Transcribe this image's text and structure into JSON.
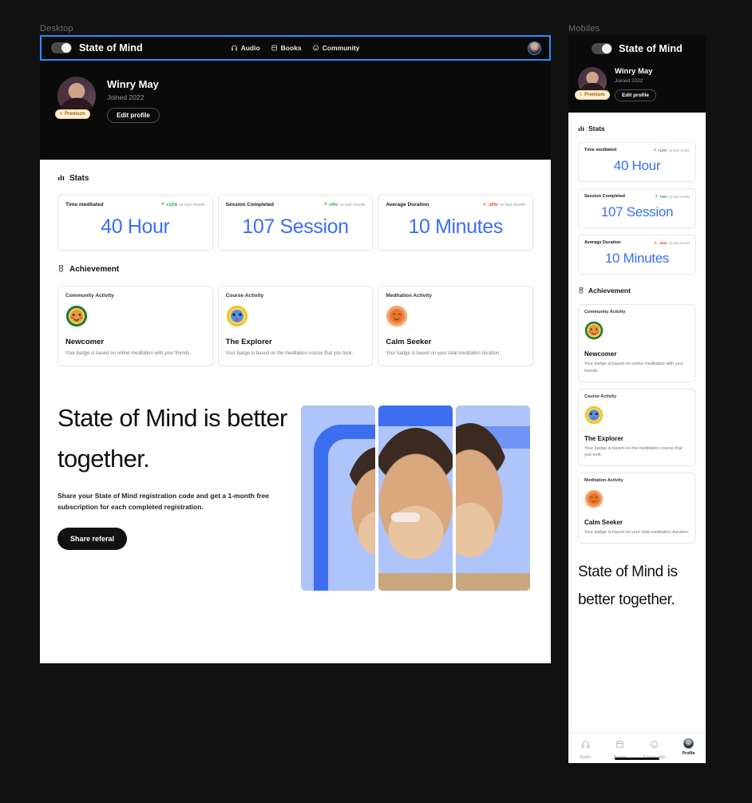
{
  "frames": {
    "desktop_label": "Desktop",
    "mobile_label": "Mobiles"
  },
  "brand": {
    "name": "State of Mind",
    "toggle_icon": "toggle-switch-icon"
  },
  "topnav": [
    {
      "label": "Audio",
      "icon": "headphones-icon"
    },
    {
      "label": "Books",
      "icon": "book-icon"
    },
    {
      "label": "Community",
      "icon": "smiley-icon"
    }
  ],
  "profile": {
    "name": "Winry May",
    "joined": "Joined 2022",
    "premium_label": "Premium",
    "premium_icon": "trophy-icon",
    "edit_label": "Edit profile",
    "avatar_icon": "user-avatar"
  },
  "stats_section": {
    "title": "Stats",
    "icon": "bar-chart-icon"
  },
  "stats": [
    {
      "label": "Time meditated",
      "pct": "+12%",
      "direction": "up",
      "vs": "vs last month",
      "value": "40 Hour"
    },
    {
      "label": "Session Completed",
      "pct": "+5%",
      "direction": "up",
      "vs": "vs last month",
      "value": "107 Session"
    },
    {
      "label": "Average Duration",
      "pct": "-10%",
      "direction": "down",
      "vs": "vs last month",
      "value": "10 Minutes"
    }
  ],
  "achievement_section": {
    "title": "Achievement",
    "icon": "medal-icon"
  },
  "achievements": [
    {
      "kind": "Community Activity",
      "name": "Newcomer",
      "desc": "Your badge is based on online meditation with your friends.",
      "badge_icon": "green-face-badge",
      "ring": "#1f7a3a",
      "face": "#e8963c",
      "glow": "#f2d24a"
    },
    {
      "kind": "Course Activity",
      "name": "The Explorer",
      "desc": "Your badge is based on the meditation course that you took.",
      "badge_icon": "yellow-face-badge",
      "ring": "#f2c22e",
      "face": "#4f8fe0",
      "glow": "#f5d23f"
    },
    {
      "kind": "Meditation Activity",
      "name": "Calm Seeker",
      "desc": "Your badge is based on your total meditation duration.",
      "badge_icon": "orange-face-badge",
      "ring": "#f08a4b",
      "face": "#e8742c",
      "glow": "#f7a977"
    }
  ],
  "referral": {
    "title": "State of Mind is better together.",
    "body": "Share your State of Mind registration code and get a 1-month free subscription for each completed registration.",
    "button_label": "Share referal",
    "image_alt": "smiling-man-photo"
  },
  "mobile_hero": {
    "title": "State of Mind is better together."
  },
  "tabbar": [
    {
      "label": "Audio",
      "icon": "headphones-icon",
      "active": false
    },
    {
      "label": "Books",
      "icon": "book-icon",
      "active": false
    },
    {
      "label": "Community",
      "icon": "smiley-icon",
      "active": false
    },
    {
      "label": "Profile",
      "icon": "user-avatar",
      "active": true
    }
  ],
  "colors": {
    "accent_blue": "#3b6ef5",
    "frame_border": "#2d8cf5",
    "dark": "#0a0a0a",
    "up_green": "#1a9e4b",
    "down_red": "#e0342b",
    "premium_bg": "#fdf0d2",
    "premium_text": "#a06a12"
  }
}
